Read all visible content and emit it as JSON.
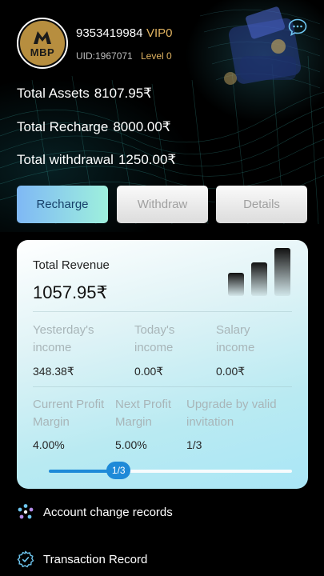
{
  "profile": {
    "avatar_text": "MBP",
    "phone": "9353419984",
    "vip": "VIP0",
    "uid": "UID:1967071",
    "level": "Level 0"
  },
  "stats": {
    "total_assets_label": "Total Assets",
    "total_assets_value": "8107.95₹",
    "total_recharge_label": "Total Recharge",
    "total_recharge_value": "8000.00₹",
    "total_withdrawal_label": "Total withdrawal",
    "total_withdrawal_value": "1250.00₹"
  },
  "actions": {
    "recharge": "Recharge",
    "withdraw": "Withdraw",
    "details": "Details"
  },
  "revenue": {
    "title": "Total Revenue",
    "value": "1057.95₹",
    "yesterday_label": "Yesterday's income",
    "yesterday_value": "348.38₹",
    "today_label": "Today's income",
    "today_value": "0.00₹",
    "salary_label": "Salary income",
    "salary_value": "0.00₹",
    "current_margin_label": "Current Profit Margin",
    "current_margin_value": "4.00%",
    "next_margin_label": "Next Profit Margin",
    "next_margin_value": "5.00%",
    "upgrade_label": "Upgrade by valid invitation",
    "upgrade_value": "1/3",
    "progress_text": "1/3",
    "progress_fraction": 0.287
  },
  "menu": {
    "account_records": "Account change records",
    "transaction_record": "Transaction Record"
  },
  "colors": {
    "accent_gold": "#e0b361",
    "accent_blue": "#1e8ad8",
    "recharge_gradient_start": "#7fb8f5",
    "recharge_gradient_end": "#9ef0dd"
  },
  "icons": {
    "chat": "chat-bubble-icon",
    "bar_chart": "bar-chart-icon",
    "account_records": "records-icon",
    "transaction": "transaction-gear-icon"
  }
}
